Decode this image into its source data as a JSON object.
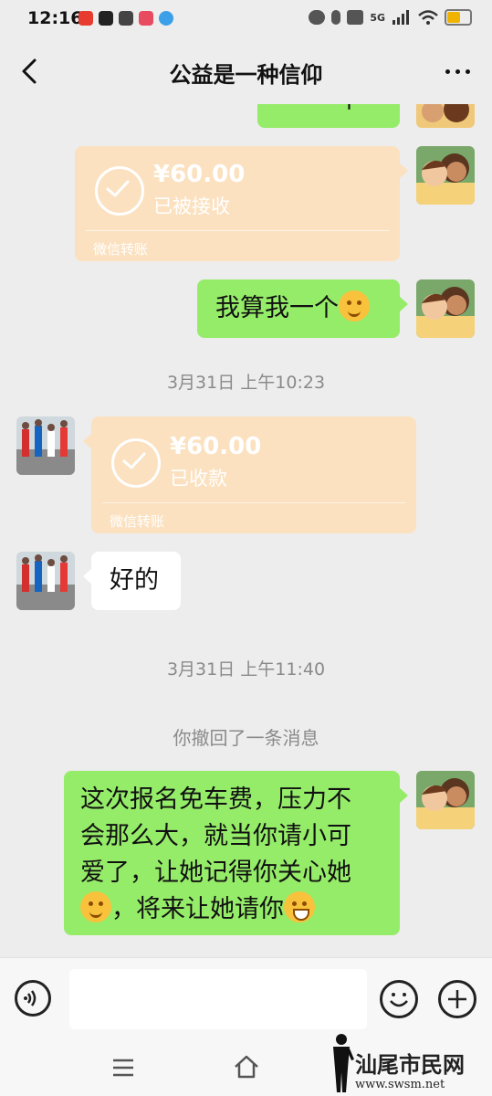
{
  "status_bar": {
    "time": "12:16",
    "network": "5G"
  },
  "header": {
    "title": "公益是一种信仰"
  },
  "messages": {
    "partial_top": "一个",
    "transfer_1": {
      "amount": "¥60.00",
      "status": "已被接收",
      "label": "微信转账"
    },
    "text_1": "我算我一个",
    "timestamp_1": "3月31日 上午10:23",
    "transfer_2": {
      "amount": "¥60.00",
      "status": "已收款",
      "label": "微信转账"
    },
    "text_2": "好的",
    "timestamp_2": "3月31日 上午11:40",
    "system_recall": "你撤回了一条消息",
    "text_3_line1": "这次报名免车费，压力不",
    "text_3_line2": "会那么大，就当你请小可",
    "text_3_line3": "爱了，让她记得你关心她",
    "text_3_line4": "，将来让她请你"
  },
  "watermark": {
    "text": "汕尾市民网",
    "url": "www.swsm.net"
  },
  "colors": {
    "green_bubble": "#95ec69",
    "transfer_bubble": "#fbe1c0",
    "background": "#ededed"
  }
}
